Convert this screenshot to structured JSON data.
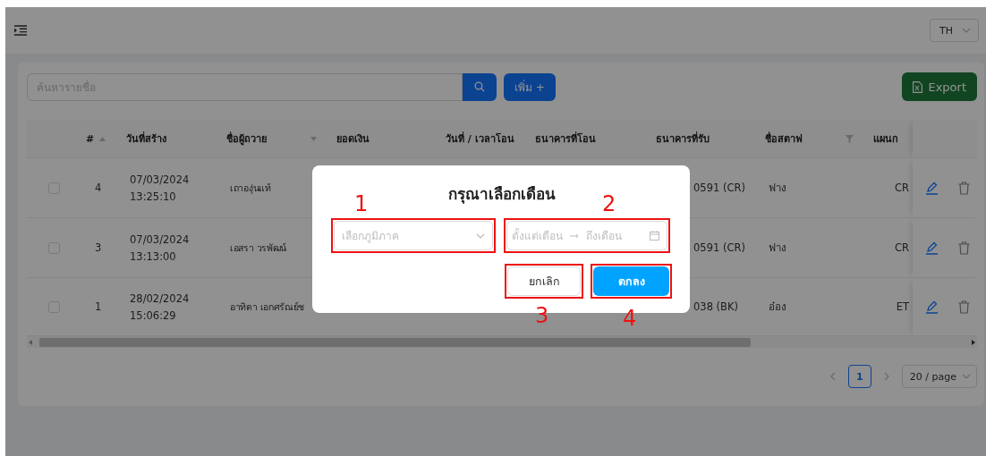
{
  "header": {
    "language": "TH"
  },
  "toolbar": {
    "search_placeholder": "ค้นหารายชื่อ",
    "add_button": "เพิ่ม +",
    "export_button": "Export"
  },
  "table": {
    "columns": [
      {
        "label": "#",
        "sorted_ascending": true
      },
      {
        "label": "วันที่สร้าง"
      },
      {
        "label": "ชื่อผู้ถวาย",
        "sorted_descending": true
      },
      {
        "label": "ยอดเงิน"
      },
      {
        "label": "วันที่ / เวลาโอน"
      },
      {
        "label": "ธนาคารที่โอน"
      },
      {
        "label": "ธนาคารที่รับ"
      },
      {
        "label": "ชื่อสตาฟ",
        "filterable": true
      },
      {
        "label": "แผนก"
      }
    ],
    "rows": [
      {
        "selected": false,
        "number": "4",
        "created": [
          "07/03/2024",
          "13:25:10"
        ],
        "donor": "เถาองุ่นแท้",
        "bank_received": "0591 (CR)",
        "staff": "ฟาง",
        "department": "CR"
      },
      {
        "selected": false,
        "number": "3",
        "created": [
          "07/03/2024",
          "13:13:00"
        ],
        "donor": "เอสรา วรพัฒน์",
        "bank_received": "0591 (CR)",
        "staff": "ฟาง",
        "department": "CR"
      },
      {
        "selected": false,
        "number": "1",
        "created": [
          "28/02/2024",
          "15:06:29"
        ],
        "donor": "อาทิตา เอกศรัณย์ช",
        "bank_received": "038 (BK)",
        "staff": "อ๋อง",
        "department": "ET"
      }
    ]
  },
  "pagination": {
    "pages": [
      {
        "label": "1",
        "selected": true
      }
    ],
    "page_size": "20 / page"
  },
  "modal": {
    "title": "กรุณาเลือกเดือน",
    "region_placeholder": "เลือกภูมิภาค",
    "range_start_placeholder": "ตั้งแต่เดือน",
    "range_end_placeholder": "ถึงเดือน",
    "cancel_button": "ยกเลิก",
    "ok_button": "ตกลง",
    "annotations": [
      "1",
      "2",
      "3",
      "4"
    ]
  }
}
